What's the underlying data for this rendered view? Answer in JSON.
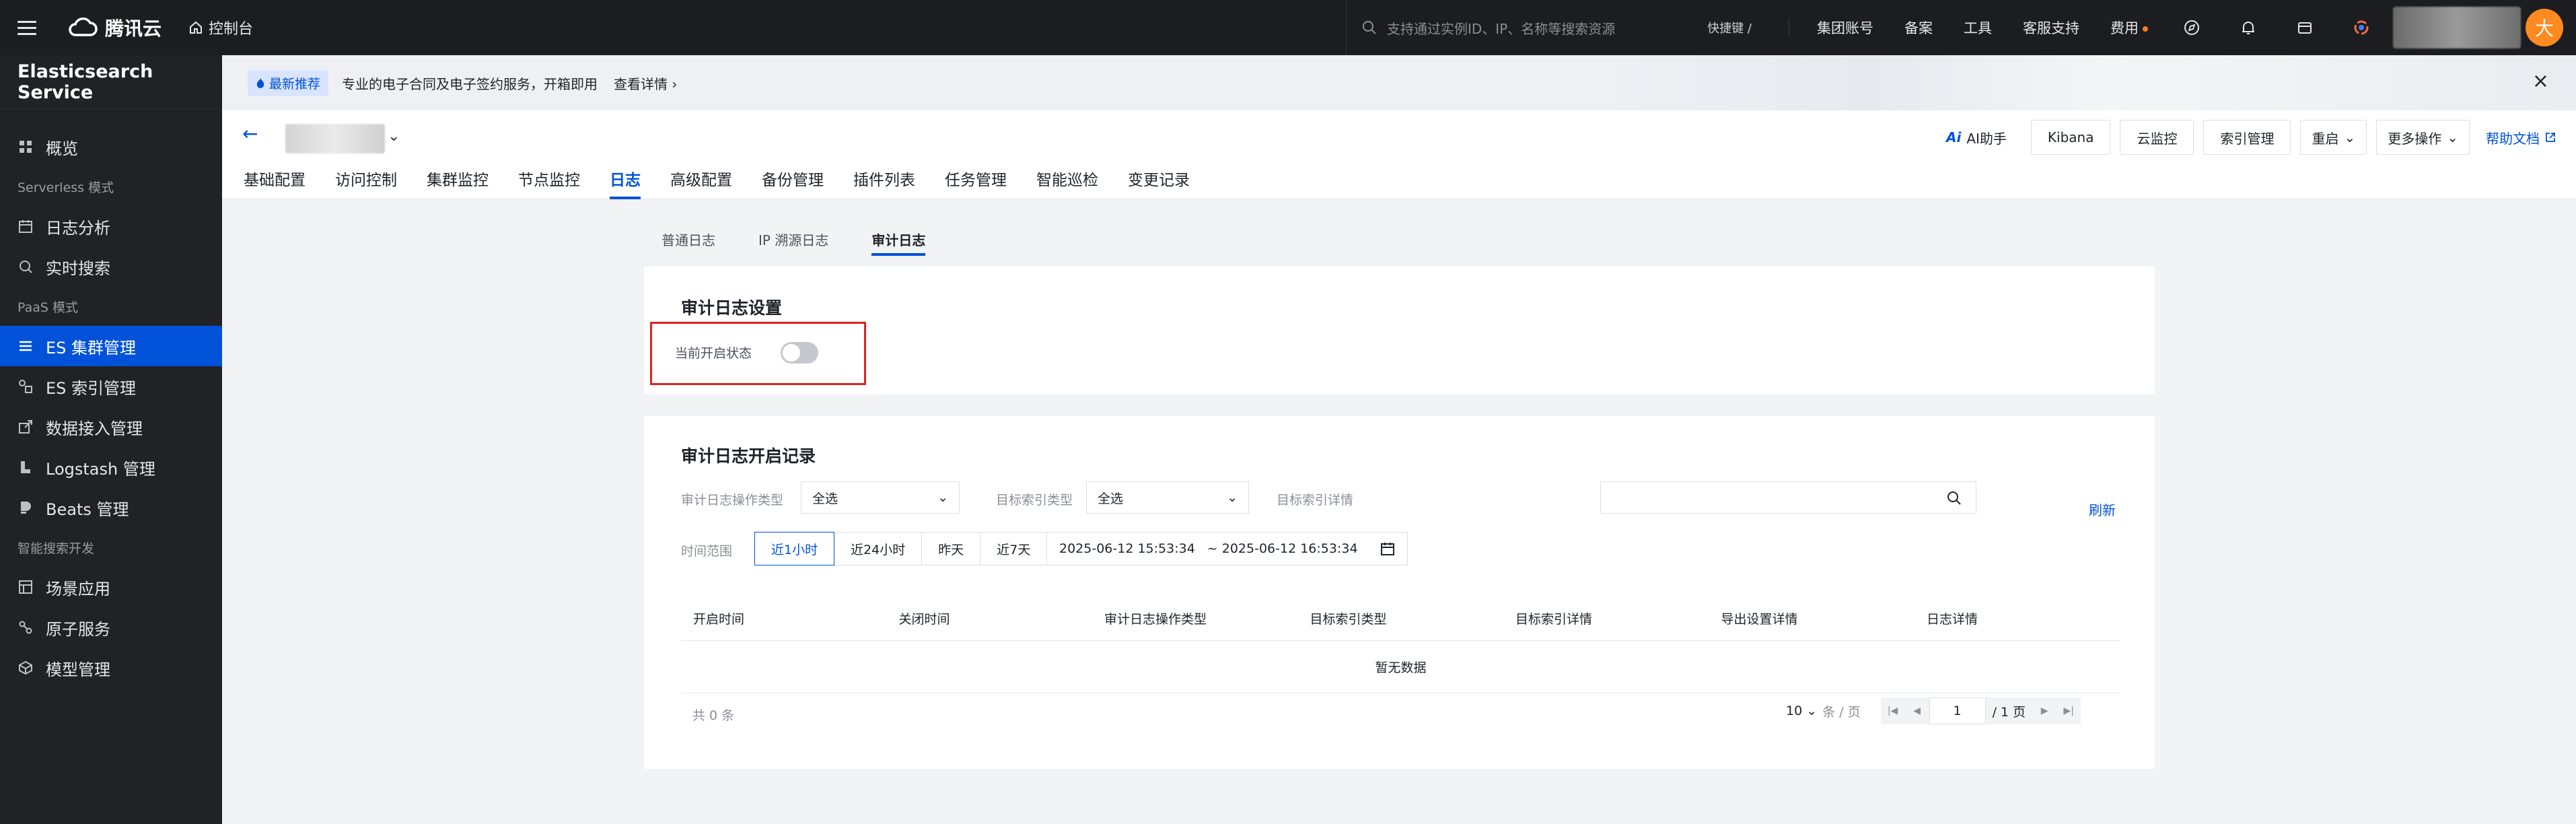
{
  "topbar": {
    "brand": "腾讯云",
    "console": "控制台",
    "search_placeholder": "支持通过实例ID、IP、名称等搜索资源",
    "shortcut": "快捷键 /",
    "links": [
      "集团账号",
      "备案",
      "工具",
      "客服支持",
      "费用"
    ],
    "avatar_initial": "大"
  },
  "sidebar": {
    "title": "Elasticsearch Service",
    "overview": "概览",
    "group_serverless": "Serverless 模式",
    "log_analysis": "日志分析",
    "realtime_search": "实时搜索",
    "group_paas": "PaaS 模式",
    "es_cluster": "ES 集群管理",
    "es_index": "ES 索引管理",
    "data_ingest": "数据接入管理",
    "logstash": "Logstash 管理",
    "beats": "Beats 管理",
    "group_smart": "智能搜索开发",
    "scenario": "场景应用",
    "atomic": "原子服务",
    "model": "模型管理"
  },
  "banner": {
    "tag": "最新推荐",
    "text": "专业的电子合同及电子签约服务，开箱即用",
    "more": "查看详情"
  },
  "header": {
    "ai_helper": "AI助手",
    "buttons": [
      "Kibana",
      "云监控",
      "索引管理"
    ],
    "restart": "重启",
    "more_ops": "更多操作",
    "help": "帮助文档",
    "tabs": [
      "基础配置",
      "访问控制",
      "集群监控",
      "节点监控",
      "日志",
      "高级配置",
      "备份管理",
      "插件列表",
      "任务管理",
      "智能巡检",
      "变更记录"
    ],
    "active_tab": "日志"
  },
  "subtabs": [
    "普通日志",
    "IP 溯源日志",
    "审计日志"
  ],
  "audit_settings": {
    "title": "审计日志设置",
    "status_label": "当前开启状态",
    "enabled": false
  },
  "audit_records": {
    "title": "审计日志开启记录",
    "op_type_label": "审计日志操作类型",
    "op_type_value": "全选",
    "target_type_label": "目标索引类型",
    "target_type_value": "全选",
    "target_detail_label": "目标索引详情",
    "refresh": "刷新",
    "time_label": "时间范围",
    "ranges": [
      "近1小时",
      "近24小时",
      "昨天",
      "近7天"
    ],
    "active_range": "近1小时",
    "start": "2025-06-12 15:53:34",
    "end": "~ 2025-06-12 16:53:34",
    "columns": [
      "开启时间",
      "关闭时间",
      "审计日志操作类型",
      "目标索引类型",
      "目标索引详情",
      "导出设置详情",
      "日志详情"
    ],
    "empty": "暂无数据",
    "total": "共 0 条",
    "page_size": "10",
    "page_unit": "条 / 页",
    "page": "1",
    "page_total": "/ 1 页"
  }
}
